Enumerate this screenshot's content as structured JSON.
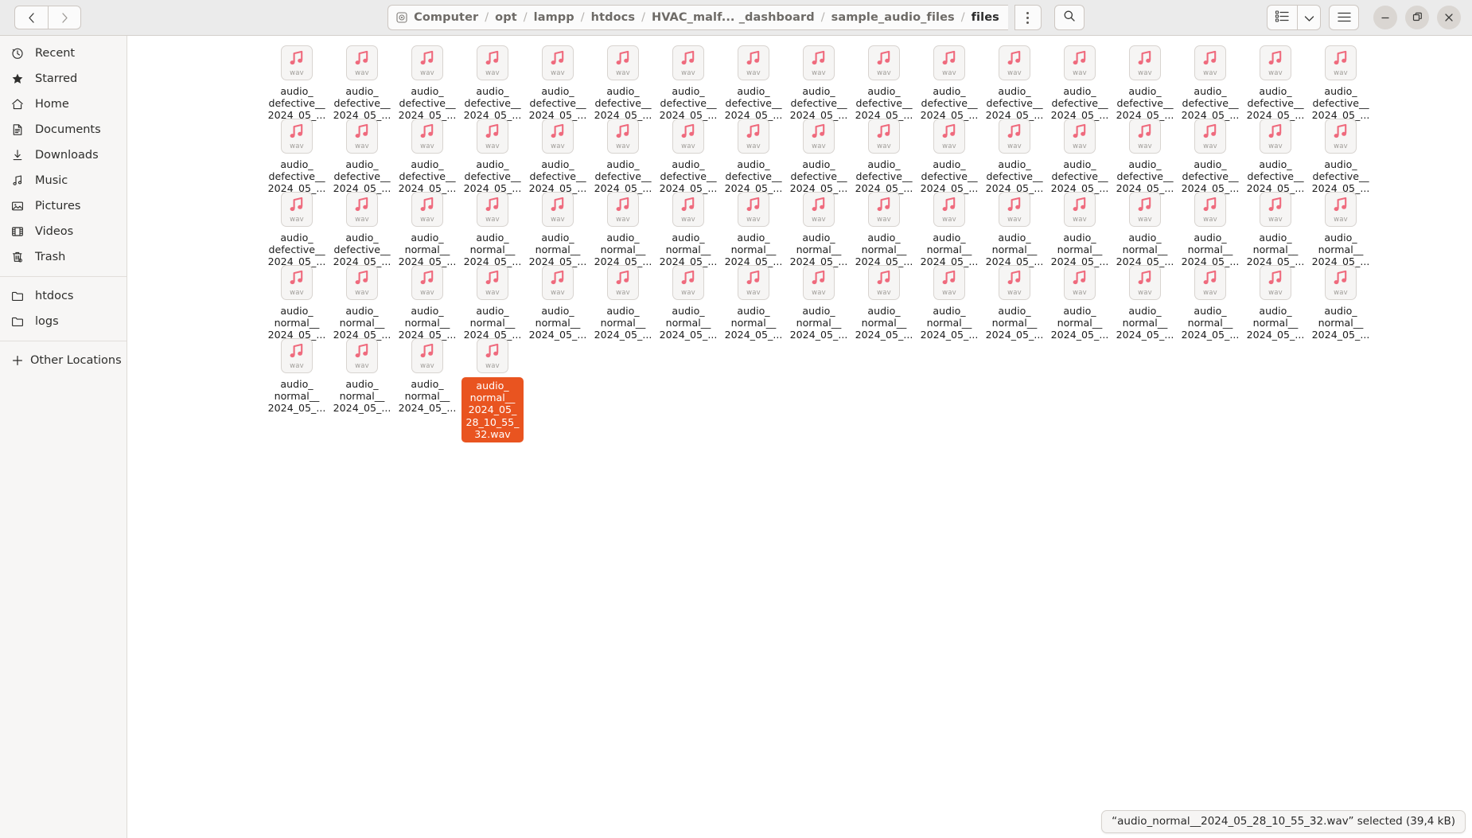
{
  "window": {
    "title": "files",
    "accent_selection": "#e95420",
    "icon_note_color": "#ef6a7d"
  },
  "header": {
    "back_label": "Back",
    "forward_label": "Forward",
    "breadcrumbs": [
      {
        "label": "Computer",
        "icon": "computer-icon",
        "current": false
      },
      {
        "label": "opt",
        "current": false
      },
      {
        "label": "lampp",
        "current": false
      },
      {
        "label": "htdocs",
        "current": false
      },
      {
        "label": "HVAC_malf... _dashboard",
        "current": false
      },
      {
        "label": "sample_audio_files",
        "current": false
      },
      {
        "label": "files",
        "current": true
      }
    ],
    "separator": "/",
    "path_menu_label": "Path options",
    "search_label": "Search",
    "view_toggle_label": "List view",
    "view_dropdown_label": "View options",
    "main_menu_label": "Main menu",
    "minimize_label": "Minimize",
    "maximize_label": "Maximize",
    "close_label": "Close"
  },
  "sidebar": {
    "groups": [
      {
        "items": [
          {
            "label": "Recent",
            "icon": "clock-icon"
          },
          {
            "label": "Starred",
            "icon": "star-icon"
          },
          {
            "label": "Home",
            "icon": "home-icon"
          },
          {
            "label": "Documents",
            "icon": "document-icon"
          },
          {
            "label": "Downloads",
            "icon": "download-icon"
          },
          {
            "label": "Music",
            "icon": "music-icon"
          },
          {
            "label": "Pictures",
            "icon": "image-icon"
          },
          {
            "label": "Videos",
            "icon": "video-icon"
          },
          {
            "label": "Trash",
            "icon": "trash-icon"
          }
        ]
      },
      {
        "items": [
          {
            "label": "htdocs",
            "icon": "folder-icon"
          },
          {
            "label": "logs",
            "icon": "folder-icon"
          }
        ]
      },
      {
        "items": [
          {
            "label": "Other Locations",
            "icon": "plus-icon"
          }
        ]
      }
    ]
  },
  "files": {
    "columns": 17,
    "file_extension_badge": "wav",
    "icon_name": "audio-wav-icon",
    "rows": [
      {
        "items": [
          {
            "lines": [
              "audio_",
              "defective__",
              "2024_05_..."
            ],
            "selected": false
          },
          {
            "lines": [
              "audio_",
              "defective__",
              "2024_05_..."
            ],
            "selected": false
          },
          {
            "lines": [
              "audio_",
              "defective__",
              "2024_05_..."
            ],
            "selected": false
          },
          {
            "lines": [
              "audio_",
              "defective__",
              "2024_05_..."
            ],
            "selected": false
          },
          {
            "lines": [
              "audio_",
              "defective__",
              "2024_05_..."
            ],
            "selected": false
          },
          {
            "lines": [
              "audio_",
              "defective__",
              "2024_05_..."
            ],
            "selected": false
          },
          {
            "lines": [
              "audio_",
              "defective__",
              "2024_05_..."
            ],
            "selected": false
          },
          {
            "lines": [
              "audio_",
              "defective__",
              "2024_05_..."
            ],
            "selected": false
          },
          {
            "lines": [
              "audio_",
              "defective__",
              "2024_05_..."
            ],
            "selected": false
          },
          {
            "lines": [
              "audio_",
              "defective__",
              "2024_05_..."
            ],
            "selected": false
          },
          {
            "lines": [
              "audio_",
              "defective__",
              "2024_05_..."
            ],
            "selected": false
          },
          {
            "lines": [
              "audio_",
              "defective__",
              "2024_05_..."
            ],
            "selected": false
          },
          {
            "lines": [
              "audio_",
              "defective__",
              "2024_05_..."
            ],
            "selected": false
          },
          {
            "lines": [
              "audio_",
              "defective__",
              "2024_05_..."
            ],
            "selected": false
          },
          {
            "lines": [
              "audio_",
              "defective__",
              "2024_05_..."
            ],
            "selected": false
          },
          {
            "lines": [
              "audio_",
              "defective__",
              "2024_05_..."
            ],
            "selected": false
          },
          {
            "lines": [
              "audio_",
              "defective__",
              "2024_05_..."
            ],
            "selected": false
          }
        ]
      },
      {
        "items": [
          {
            "lines": [
              "audio_",
              "defective__",
              "2024_05_..."
            ],
            "selected": false
          },
          {
            "lines": [
              "audio_",
              "defective__",
              "2024_05_..."
            ],
            "selected": false
          },
          {
            "lines": [
              "audio_",
              "defective__",
              "2024_05_..."
            ],
            "selected": false
          },
          {
            "lines": [
              "audio_",
              "defective__",
              "2024_05_..."
            ],
            "selected": false
          },
          {
            "lines": [
              "audio_",
              "defective__",
              "2024_05_..."
            ],
            "selected": false
          },
          {
            "lines": [
              "audio_",
              "defective__",
              "2024_05_..."
            ],
            "selected": false
          },
          {
            "lines": [
              "audio_",
              "defective__",
              "2024_05_..."
            ],
            "selected": false
          },
          {
            "lines": [
              "audio_",
              "defective__",
              "2024_05_..."
            ],
            "selected": false
          },
          {
            "lines": [
              "audio_",
              "defective__",
              "2024_05_..."
            ],
            "selected": false
          },
          {
            "lines": [
              "audio_",
              "defective__",
              "2024_05_..."
            ],
            "selected": false
          },
          {
            "lines": [
              "audio_",
              "defective__",
              "2024_05_..."
            ],
            "selected": false
          },
          {
            "lines": [
              "audio_",
              "defective__",
              "2024_05_..."
            ],
            "selected": false
          },
          {
            "lines": [
              "audio_",
              "defective__",
              "2024_05_..."
            ],
            "selected": false
          },
          {
            "lines": [
              "audio_",
              "defective__",
              "2024_05_..."
            ],
            "selected": false
          },
          {
            "lines": [
              "audio_",
              "defective__",
              "2024_05_..."
            ],
            "selected": false
          },
          {
            "lines": [
              "audio_",
              "defective__",
              "2024_05_..."
            ],
            "selected": false
          },
          {
            "lines": [
              "audio_",
              "defective__",
              "2024_05_..."
            ],
            "selected": false
          }
        ]
      },
      {
        "items": [
          {
            "lines": [
              "audio_",
              "defective__",
              "2024_05_..."
            ],
            "selected": false
          },
          {
            "lines": [
              "audio_",
              "defective__",
              "2024_05_..."
            ],
            "selected": false
          },
          {
            "lines": [
              "audio_",
              "normal__",
              "2024_05_..."
            ],
            "selected": false
          },
          {
            "lines": [
              "audio_",
              "normal__",
              "2024_05_..."
            ],
            "selected": false
          },
          {
            "lines": [
              "audio_",
              "normal__",
              "2024_05_..."
            ],
            "selected": false
          },
          {
            "lines": [
              "audio_",
              "normal__",
              "2024_05_..."
            ],
            "selected": false
          },
          {
            "lines": [
              "audio_",
              "normal__",
              "2024_05_..."
            ],
            "selected": false
          },
          {
            "lines": [
              "audio_",
              "normal__",
              "2024_05_..."
            ],
            "selected": false
          },
          {
            "lines": [
              "audio_",
              "normal__",
              "2024_05_..."
            ],
            "selected": false
          },
          {
            "lines": [
              "audio_",
              "normal__",
              "2024_05_..."
            ],
            "selected": false
          },
          {
            "lines": [
              "audio_",
              "normal__",
              "2024_05_..."
            ],
            "selected": false
          },
          {
            "lines": [
              "audio_",
              "normal__",
              "2024_05_..."
            ],
            "selected": false
          },
          {
            "lines": [
              "audio_",
              "normal__",
              "2024_05_..."
            ],
            "selected": false
          },
          {
            "lines": [
              "audio_",
              "normal__",
              "2024_05_..."
            ],
            "selected": false
          },
          {
            "lines": [
              "audio_",
              "normal__",
              "2024_05_..."
            ],
            "selected": false
          },
          {
            "lines": [
              "audio_",
              "normal__",
              "2024_05_..."
            ],
            "selected": false
          },
          {
            "lines": [
              "audio_",
              "normal__",
              "2024_05_..."
            ],
            "selected": false
          }
        ]
      },
      {
        "items": [
          {
            "lines": [
              "audio_",
              "normal__",
              "2024_05_..."
            ],
            "selected": false
          },
          {
            "lines": [
              "audio_",
              "normal__",
              "2024_05_..."
            ],
            "selected": false
          },
          {
            "lines": [
              "audio_",
              "normal__",
              "2024_05_..."
            ],
            "selected": false
          },
          {
            "lines": [
              "audio_",
              "normal__",
              "2024_05_..."
            ],
            "selected": false
          },
          {
            "lines": [
              "audio_",
              "normal__",
              "2024_05_..."
            ],
            "selected": false
          },
          {
            "lines": [
              "audio_",
              "normal__",
              "2024_05_..."
            ],
            "selected": false
          },
          {
            "lines": [
              "audio_",
              "normal__",
              "2024_05_..."
            ],
            "selected": false
          },
          {
            "lines": [
              "audio_",
              "normal__",
              "2024_05_..."
            ],
            "selected": false
          },
          {
            "lines": [
              "audio_",
              "normal__",
              "2024_05_..."
            ],
            "selected": false
          },
          {
            "lines": [
              "audio_",
              "normal__",
              "2024_05_..."
            ],
            "selected": false
          },
          {
            "lines": [
              "audio_",
              "normal__",
              "2024_05_..."
            ],
            "selected": false
          },
          {
            "lines": [
              "audio_",
              "normal__",
              "2024_05_..."
            ],
            "selected": false
          },
          {
            "lines": [
              "audio_",
              "normal__",
              "2024_05_..."
            ],
            "selected": false
          },
          {
            "lines": [
              "audio_",
              "normal__",
              "2024_05_..."
            ],
            "selected": false
          },
          {
            "lines": [
              "audio_",
              "normal__",
              "2024_05_..."
            ],
            "selected": false
          },
          {
            "lines": [
              "audio_",
              "normal__",
              "2024_05_..."
            ],
            "selected": false
          },
          {
            "lines": [
              "audio_",
              "normal__",
              "2024_05_..."
            ],
            "selected": false
          }
        ]
      },
      {
        "items": [
          {
            "lines": [
              "audio_",
              "normal__",
              "2024_05_..."
            ],
            "selected": false
          },
          {
            "lines": [
              "audio_",
              "normal__",
              "2024_05_..."
            ],
            "selected": false
          },
          {
            "lines": [
              "audio_",
              "normal__",
              "2024_05_..."
            ],
            "selected": false
          },
          {
            "lines": [
              "audio_",
              "normal__",
              "2024_05_",
              "28_10_55_",
              "32.wav"
            ],
            "selected": true
          }
        ]
      }
    ]
  },
  "statusbar": {
    "text": "“audio_normal__2024_05_28_10_55_32.wav” selected (39,4 kB)"
  }
}
